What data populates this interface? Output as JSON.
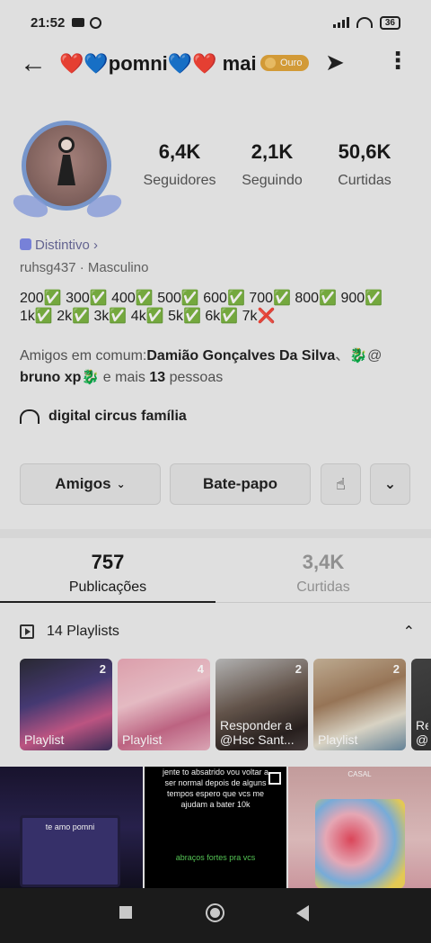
{
  "status_bar": {
    "time": "21:52",
    "battery": "36"
  },
  "header": {
    "username": "❤️💙pomni💙❤️ mai",
    "tier_label": "Ouro"
  },
  "profile": {
    "stats": [
      {
        "value": "6,4K",
        "label": "Seguidores"
      },
      {
        "value": "2,1K",
        "label": "Seguindo"
      },
      {
        "value": "50,6K",
        "label": "Curtidas"
      }
    ],
    "badge_label": "Distintivo ›",
    "handle": "ruhsg437",
    "separator": " · ",
    "gender": "Masculino",
    "bio_line1": "200✅ 300✅ 400✅ 500✅ 600✅ 700✅ 800✅ 900✅",
    "bio_line2": "1k✅ 2k✅ 3k✅ 4k✅ 5k✅ 6k✅ 7k❌",
    "friends_prefix": "Amigos em comum:",
    "friend_1": "Damião Gonçalves Da Silva",
    "friends_mid": "、🐉@",
    "friend_2": "bruno xp",
    "friends_suffix_pre": "🐉 e mais ",
    "friends_more_count": "13",
    "friends_suffix_post": " pessoas",
    "community": "digital circus família"
  },
  "actions": {
    "friends_label": "Amigos",
    "chat_label": "Bate-papo"
  },
  "tabs": [
    {
      "count": "757",
      "label": "Publicações"
    },
    {
      "count": "3,4K",
      "label": "Curtidas"
    }
  ],
  "playlists": {
    "header": "14 Playlists",
    "items": [
      {
        "count": "2",
        "caption": "Playlist"
      },
      {
        "count": "4",
        "caption": "Playlist"
      },
      {
        "count": "2",
        "caption": "Responder a @Hsc Sant..."
      },
      {
        "count": "2",
        "caption": "Playlist"
      },
      {
        "count": "",
        "caption": "Re @"
      }
    ]
  },
  "grid": {
    "tile1_text": "te amo pomni",
    "tile2_text": "jente to absatrido vou voltar a ser normal depois de alguns tempos espero que vcs me ajudam a bater  10k",
    "tile2_footer": "abraços fortes pra vcs",
    "tile3_text": "CASAL"
  }
}
